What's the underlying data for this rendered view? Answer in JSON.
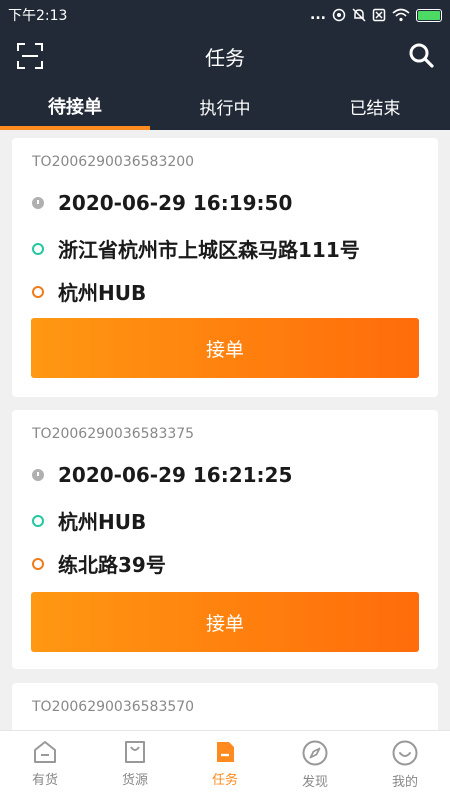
{
  "status_bar": {
    "time": "下午2:13",
    "more": "...",
    "battery_icon": "battery-charging-icon"
  },
  "header": {
    "title": "任务",
    "left_icon": "scan-icon",
    "right_icon": "search-icon"
  },
  "tabs": [
    {
      "label": "待接单",
      "active": true
    },
    {
      "label": "执行中",
      "active": false
    },
    {
      "label": "已结束",
      "active": false
    }
  ],
  "orders": [
    {
      "order_no": "TO2006290036583200",
      "time": "2020-06-29 16:19:50",
      "origin": "浙江省杭州市上城区森马路111号",
      "destination": "杭州HUB",
      "button_label": "接单"
    },
    {
      "order_no": "TO2006290036583375",
      "time": "2020-06-29 16:21:25",
      "origin": "杭州HUB",
      "destination": "练北路39号",
      "button_label": "接单"
    },
    {
      "order_no": "TO2006290036583570"
    }
  ],
  "bottom_nav": [
    {
      "label": "有货",
      "icon": "home-icon",
      "active": false
    },
    {
      "label": "货源",
      "icon": "bag-icon",
      "active": false
    },
    {
      "label": "任务",
      "icon": "task-icon",
      "active": true
    },
    {
      "label": "发现",
      "icon": "compass-icon",
      "active": false
    },
    {
      "label": "我的",
      "icon": "smile-icon",
      "active": false
    }
  ],
  "colors": {
    "header_bg": "#222a38",
    "accent": "#ff8a1f",
    "button_start": "#ff9812",
    "button_end": "#ff6c0b",
    "origin_dot": "#20c9a0",
    "destination_dot": "#f07b1a"
  }
}
